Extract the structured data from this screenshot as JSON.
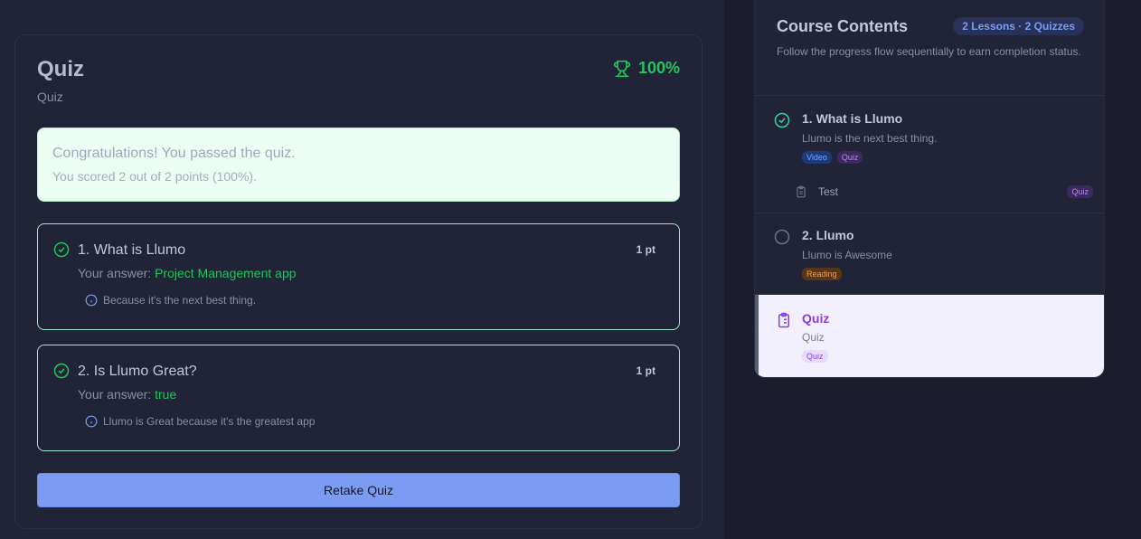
{
  "quiz": {
    "title": "Quiz",
    "subtitle": "Quiz",
    "score": "100%",
    "success_title": "Congratulations! You passed the quiz.",
    "success_text": "You scored 2 out of 2 points (100%).",
    "answer_prefix": "Your answer: ",
    "questions": [
      {
        "title": "1. What is Llumo",
        "points": "1 pt",
        "answer": "Project Management app",
        "explanation": "Because it's the next best thing."
      },
      {
        "title": "2. Is Llumo Great?",
        "points": "1 pt",
        "answer": "true",
        "explanation": "Llumo is Great because it's the greatest app"
      }
    ],
    "retake_label": "Retake Quiz"
  },
  "contents": {
    "title": "Course Contents",
    "badge": "2 Lessons · 2 Quizzes",
    "description": "Follow the progress flow sequentially to earn completion status.",
    "lessons": [
      {
        "title": "1. What is Llumo",
        "description": "Llumo is the next best thing.",
        "tags": [
          "Video",
          "Quiz"
        ],
        "sub_item": {
          "label": "Test",
          "tag": "Quiz"
        }
      },
      {
        "title": "2. Llumo",
        "description": "Llumo is Awesome",
        "tags": [
          "Reading"
        ]
      }
    ],
    "active": {
      "title": "Quiz",
      "description": "Quiz",
      "tag": "Quiz"
    }
  },
  "colors": {
    "success": "#22c55e",
    "primary": "#7c9cf4",
    "quiz_accent": "#8b3fd9"
  }
}
